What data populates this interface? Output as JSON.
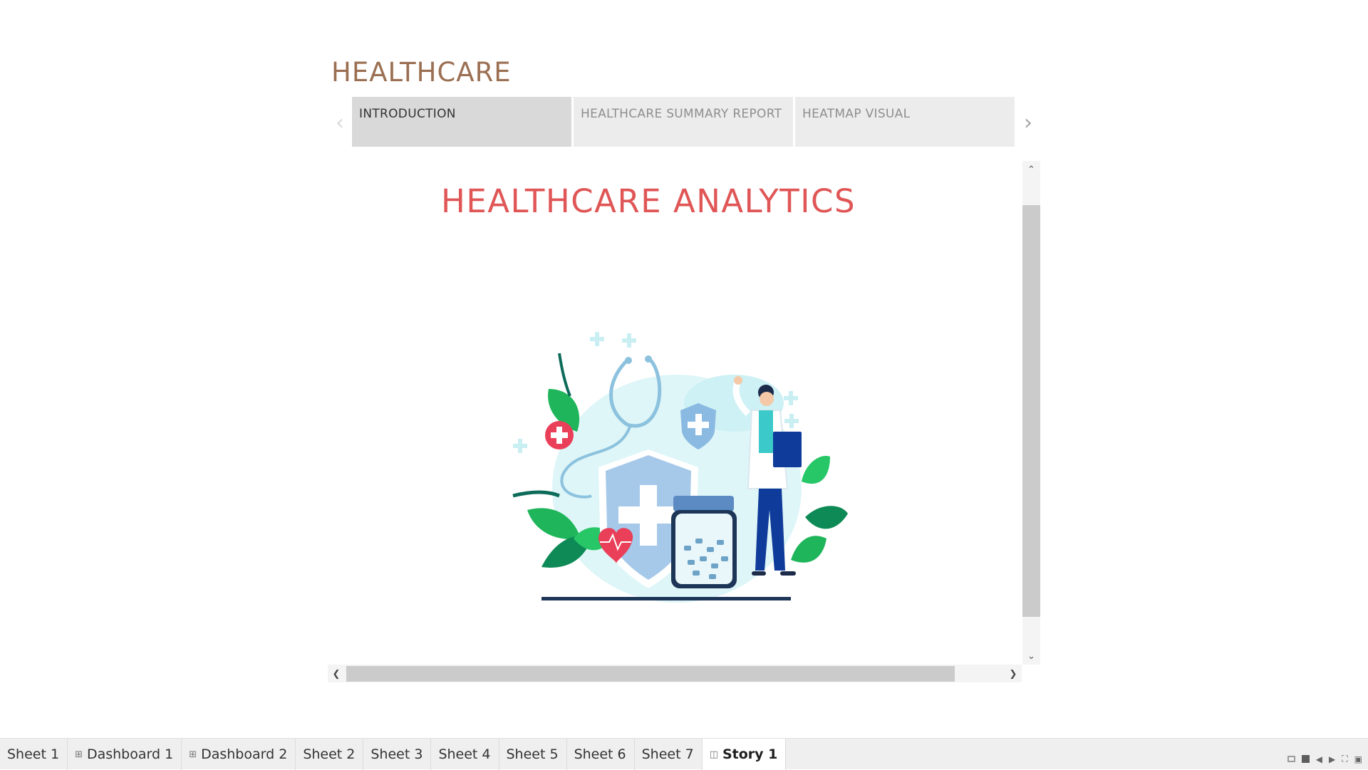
{
  "story": {
    "title": "HEALTHCARE",
    "prev_icon": "chevron-left-icon",
    "next_icon": "chevron-right-icon",
    "points": [
      {
        "label": "INTRODUCTION",
        "active": true
      },
      {
        "label": "HEALTHCARE SUMMARY REPORT",
        "active": false
      },
      {
        "label": "HEATMAP VISUAL",
        "active": false
      }
    ]
  },
  "content": {
    "headline": "HEALTHCARE ANALYTICS",
    "illustration": "doctor-healthcare-illustration"
  },
  "scroll": {
    "up_icon": "chevron-up-icon",
    "down_icon": "chevron-down-icon",
    "left_icon": "chevron-left-icon",
    "right_icon": "chevron-right-icon"
  },
  "tabs": [
    {
      "label": "Sheet 1",
      "icon": ""
    },
    {
      "label": "Dashboard 1",
      "icon": "dashboard-icon"
    },
    {
      "label": "Dashboard 2",
      "icon": "dashboard-icon"
    },
    {
      "label": "Sheet 2",
      "icon": ""
    },
    {
      "label": "Sheet 3",
      "icon": ""
    },
    {
      "label": "Sheet 4",
      "icon": ""
    },
    {
      "label": "Sheet 5",
      "icon": ""
    },
    {
      "label": "Sheet 6",
      "icon": ""
    },
    {
      "label": "Sheet 7",
      "icon": ""
    },
    {
      "label": "Story 1",
      "icon": "story-icon",
      "active": true
    }
  ],
  "colors": {
    "title": "#9b6f52",
    "headline": "#e05656",
    "active_point": "#d9d9d9",
    "inactive_point": "#ececec"
  }
}
